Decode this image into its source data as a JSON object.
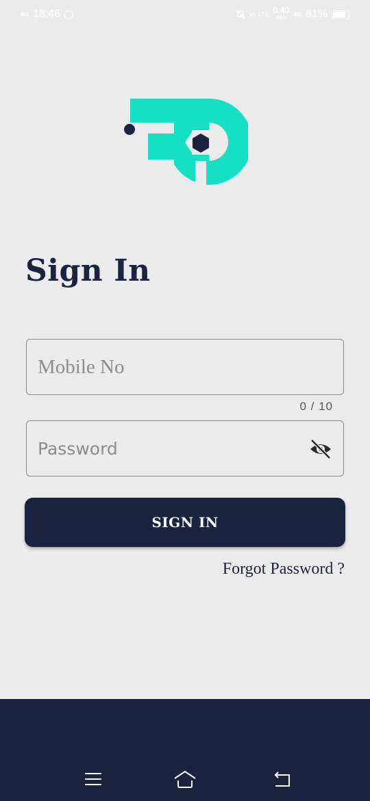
{
  "status_bar": {
    "network_left": "4G",
    "time": "18:46",
    "volte": "Vo LTE",
    "speed_value": "0.40",
    "speed_unit": "KB/s",
    "network_right": "4G",
    "battery": "81%",
    "battery_level": 0.81
  },
  "brand": {
    "primary_color": "#15e0c3",
    "dark_color": "#1c2340"
  },
  "signin": {
    "title": "Sign In",
    "mobile_placeholder": "Mobile No",
    "mobile_counter": "0 / 10",
    "password_placeholder": "Password",
    "button_label": "SIGN IN",
    "forgot_link": "Forgot Password ?"
  },
  "nav_bar": {
    "icons": [
      "menu-icon",
      "home-icon",
      "back-icon"
    ]
  }
}
